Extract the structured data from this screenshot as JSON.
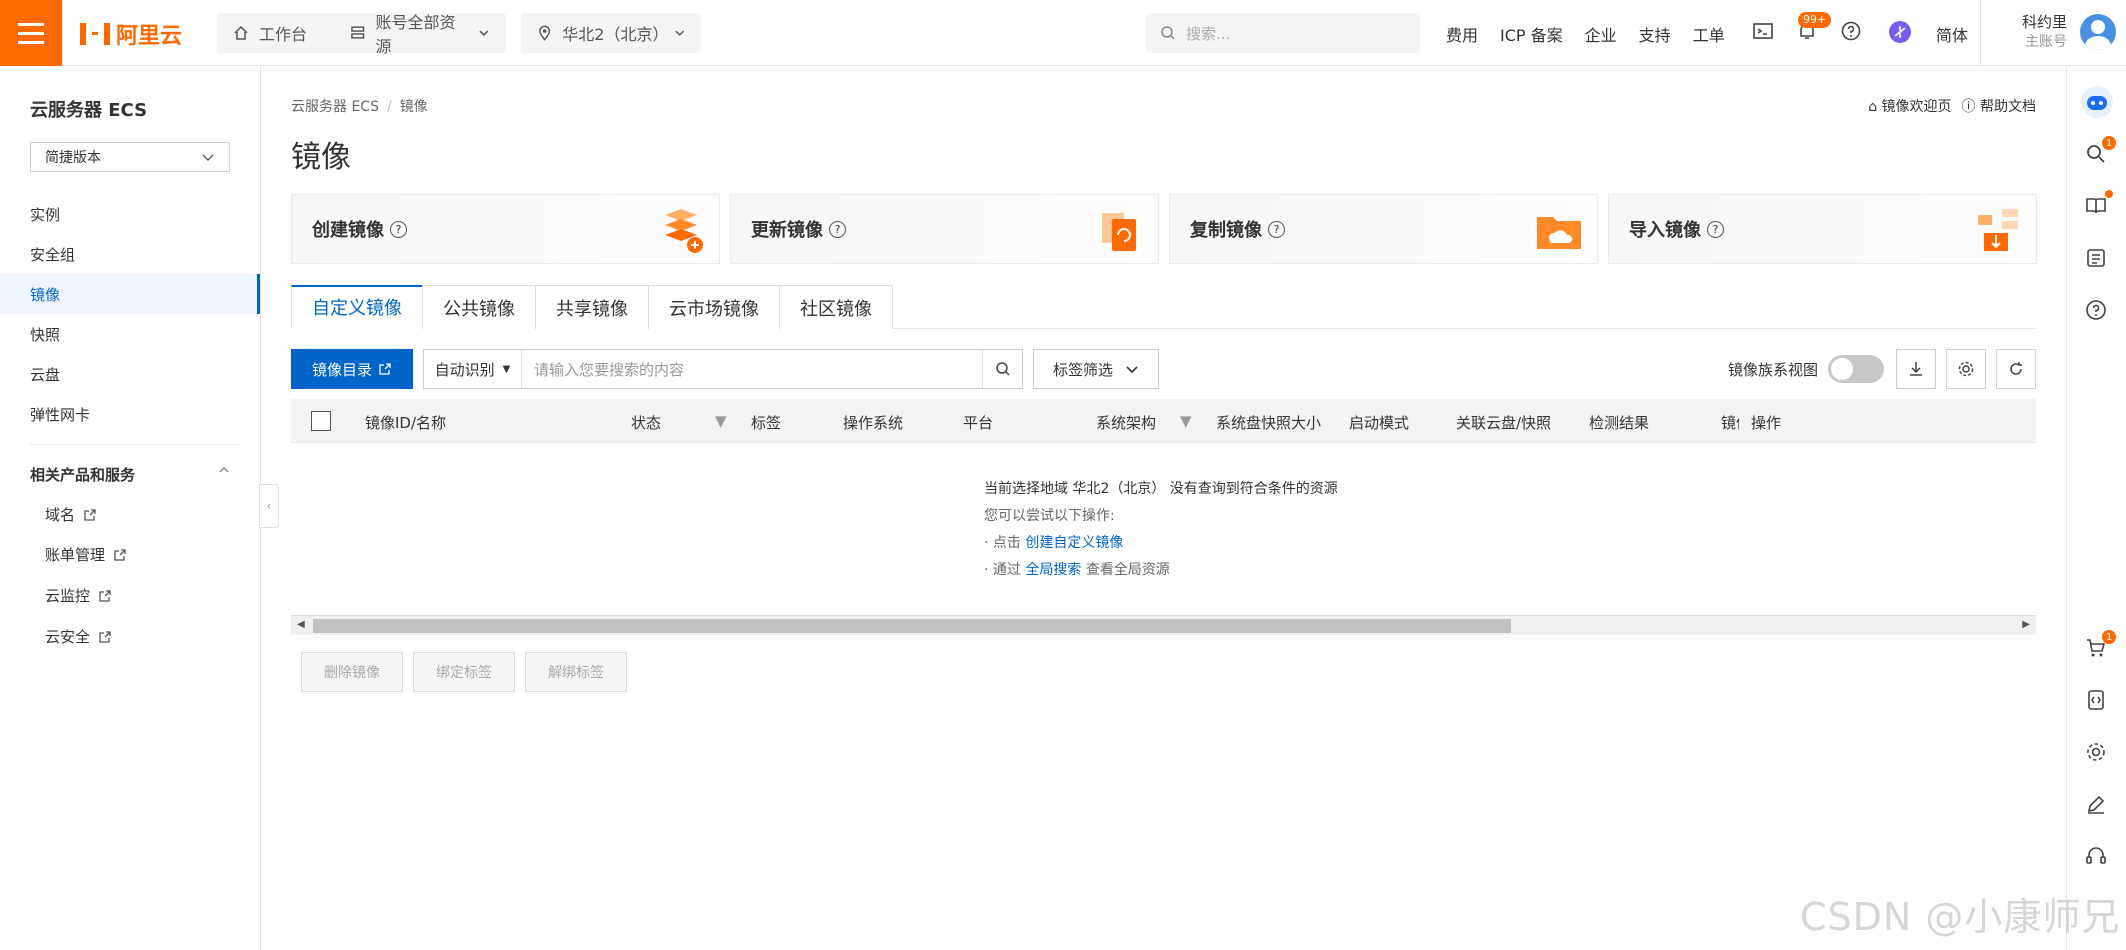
{
  "topbar": {
    "logo_text": "阿里云",
    "workbench": "工作台",
    "resources": "账号全部资源",
    "region": "华北2（北京）",
    "search_placeholder": "搜索...",
    "links": [
      "费用",
      "ICP 备案",
      "企业",
      "支持",
      "工单"
    ],
    "notification_badge": "99+",
    "language": "简体",
    "user_name": "科约里",
    "user_sub": "主账号",
    "accent": "#ff6a00"
  },
  "sidebar": {
    "title": "云服务器 ECS",
    "version_select": "简捷版本",
    "items": [
      "实例",
      "安全组",
      "镜像",
      "快照",
      "云盘",
      "弹性网卡"
    ],
    "active_item": "镜像",
    "section_title": "相关产品和服务",
    "related_links": [
      "域名",
      "账单管理",
      "云监控",
      "云安全"
    ]
  },
  "main": {
    "breadcrumb": [
      "云服务器 ECS",
      "镜像"
    ],
    "title": "镜像",
    "help_welcome": "镜像欢迎页",
    "help_docs": "帮助文档",
    "cards": [
      "创建镜像",
      "更新镜像",
      "复制镜像",
      "导入镜像"
    ],
    "tabs": [
      "自定义镜像",
      "公共镜像",
      "共享镜像",
      "云市场镜像",
      "社区镜像"
    ],
    "active_tab": "自定义镜像",
    "catalog_button": "镜像目录",
    "search_mode": "自动识别",
    "search_placeholder": "请输入您要搜索的内容",
    "tag_filter": "标签筛选",
    "family_view": "镜像族系视图",
    "columns": [
      "镜像ID/名称",
      "状态",
      "标签",
      "操作系统",
      "平台",
      "系统架构",
      "系统盘快照大小",
      "启动模式",
      "关联云盘/快照",
      "检测结果",
      "镜像",
      "操作"
    ],
    "empty_line1": "当前选择地域 华北2（北京） 没有查询到符合条件的资源",
    "empty_line2": "您可以尝试以下操作:",
    "empty_action1_prefix": "点击",
    "empty_action1_link": "创建自定义镜像",
    "empty_action2_prefix": "通过",
    "empty_action2_link": "全局搜索",
    "empty_action2_suffix": "查看全局资源",
    "bulk_actions": [
      "删除镜像",
      "绑定标签",
      "解绑标签"
    ],
    "primary_color": "#0064c8"
  },
  "rightbar": {
    "search_badge": "1",
    "cart_badge": "1"
  },
  "watermark": "CSDN @小康师兄"
}
